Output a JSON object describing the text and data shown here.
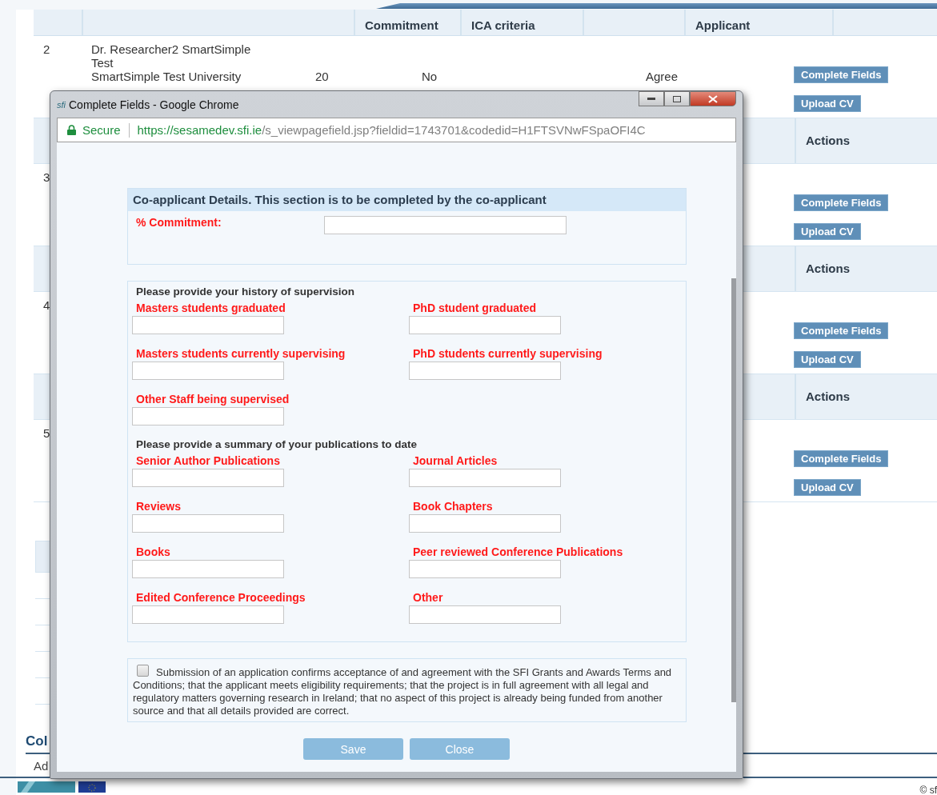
{
  "table": {
    "header": {
      "column_3": "Commitment",
      "column_4": "ICA criteria",
      "column_6": "Applicant"
    },
    "rows": [
      {
        "number": "2",
        "details": [
          "Dr. Researcher2 SmartSimple Test",
          "SmartSimple Test University"
        ],
        "commitment": "20",
        "criteria": "No",
        "applicant": "Agree",
        "actions": [
          "Complete Fields",
          "Upload CV"
        ]
      },
      {
        "subheader": "Actions",
        "number": "3",
        "actions": [
          "Complete Fields",
          "Upload CV"
        ]
      },
      {
        "subheader": "Actions",
        "number": "4",
        "actions": [
          "Complete Fields",
          "Upload CV"
        ]
      },
      {
        "subheader": "Actions",
        "number": "5",
        "actions": [
          "Complete Fields",
          "Upload CV"
        ]
      }
    ]
  },
  "section_heading": "Col",
  "section_tab": "Ad",
  "footer": {
    "copyright": "© sf"
  },
  "popup": {
    "title": "Complete Fields - Google Chrome",
    "app_icon_text": "sfi",
    "secure": "Secure",
    "url_host": "https://sesamedev.sfi.ie",
    "url_path": "/s_viewpagefield.jsp?fieldid=1743701&codedid=H1FTSVNwFSpaOFI4C",
    "form_title": "Co-applicant Details. This section is to be completed by the co-applicant",
    "commitment_label": "% Commitment:",
    "rows": [
      {
        "kind": "heading",
        "text": "Please provide your history of supervision"
      },
      {
        "kind": "fields",
        "labels": [
          "Masters students graduated",
          "PhD student graduated"
        ]
      },
      {
        "kind": "fields",
        "labels": [
          "Masters students currently supervising",
          "PhD students currently supervising"
        ]
      },
      {
        "kind": "fields",
        "labels": [
          "Other Staff being supervised"
        ]
      },
      {
        "kind": "heading",
        "text": "Please provide a summary of your publications to date"
      },
      {
        "kind": "fields",
        "labels": [
          "Senior Author Publications",
          "Journal Articles"
        ]
      },
      {
        "kind": "fields",
        "labels": [
          "Reviews",
          "Book Chapters"
        ]
      },
      {
        "kind": "fields",
        "labels": [
          "Books",
          "Peer reviewed Conference Publications"
        ]
      },
      {
        "kind": "fields",
        "labels": [
          "Edited Conference Proceedings",
          "Other"
        ]
      }
    ],
    "agreement": {
      "checked": false,
      "text": "Submission of an application confirms acceptance of and agreement with the SFI Grants and Awards Terms and Conditions; that the applicant meets eligibility requirements; that the project is in full agreement with all legal and regulatory matters governing research in Ireland; that no aspect of this project is already being funded from another source and that all details provided are correct."
    },
    "buttons": [
      "Save",
      "Close"
    ]
  }
}
